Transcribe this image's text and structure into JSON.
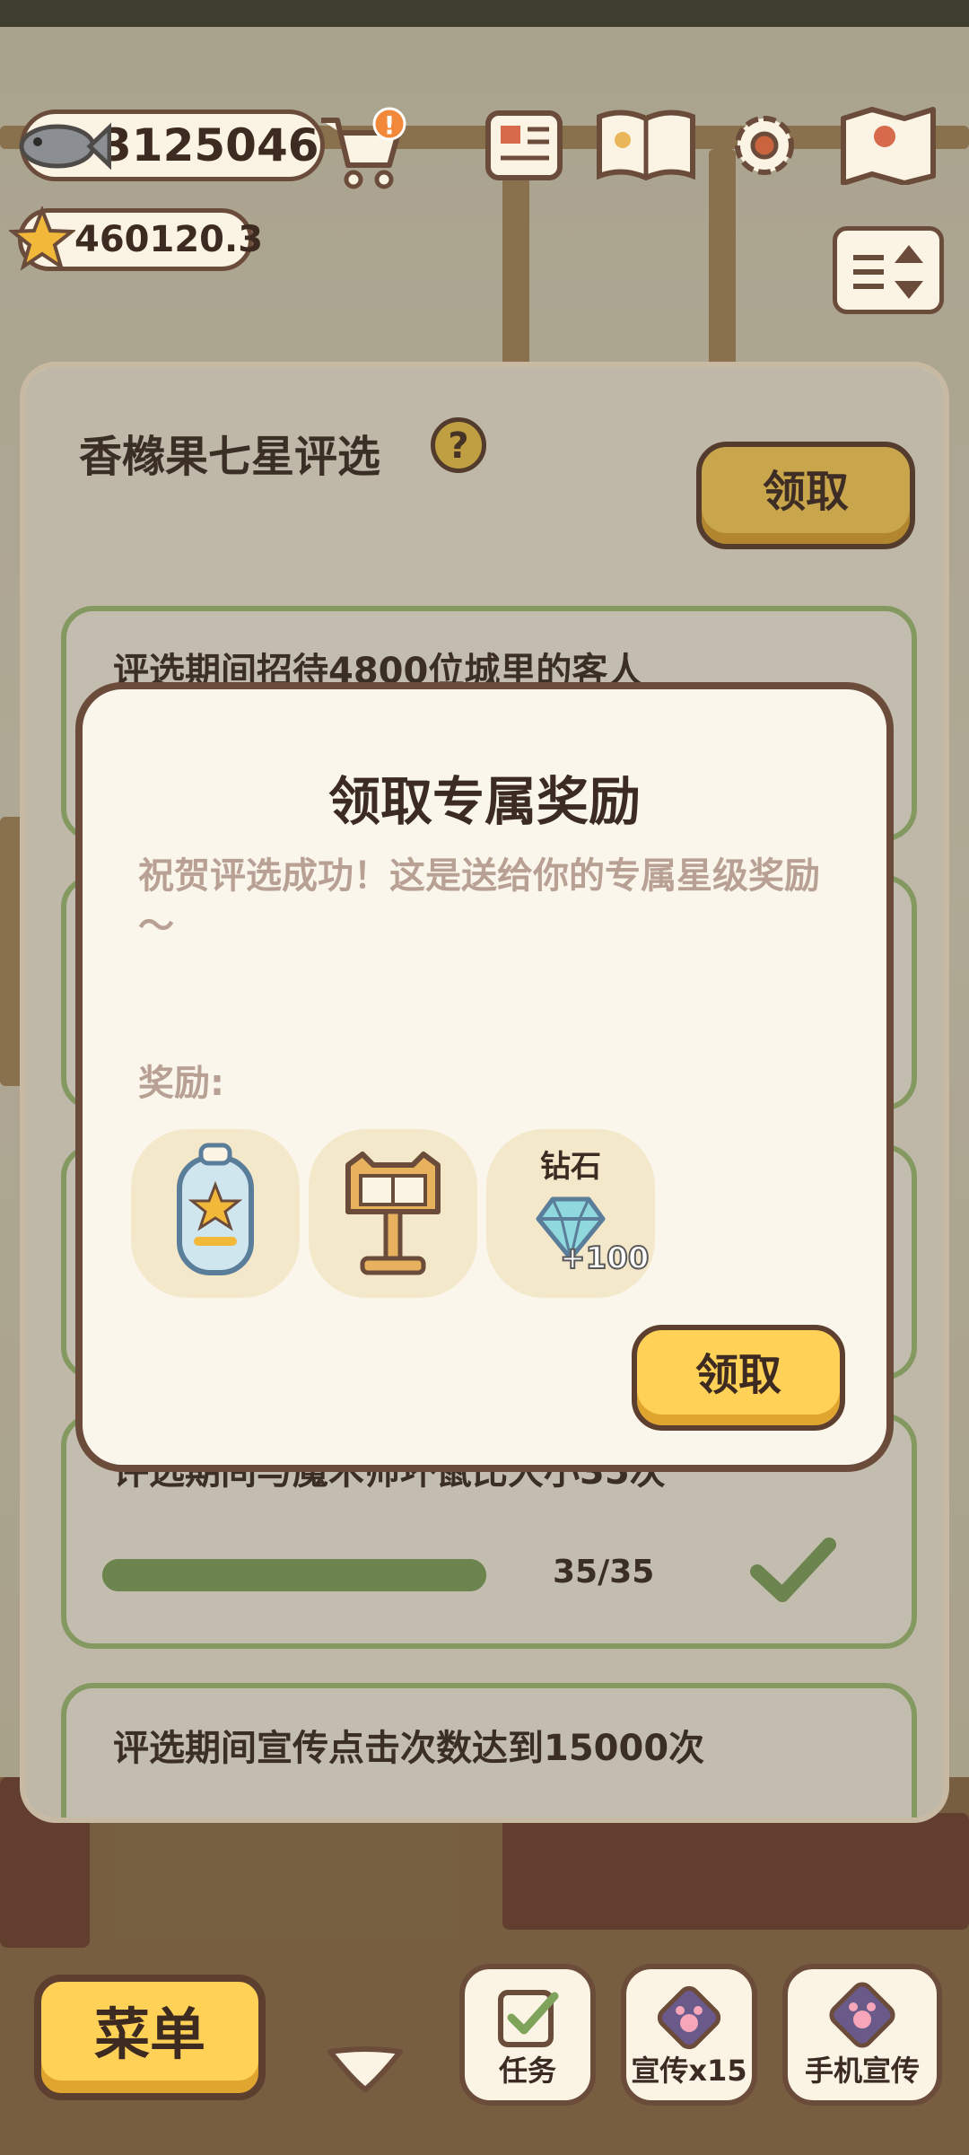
{
  "hud": {
    "fish_count": "3125046",
    "star_rating": "460120.3"
  },
  "panel": {
    "title": "香橼果七星评选",
    "claim_label": "领取",
    "tasks": [
      {
        "title": "评选期间招待4800位城里的客人"
      },
      {
        "title": "评选期间与魔术师坏鼠比大小35次",
        "progress_text": "35/35",
        "progress_fraction": 1.0
      },
      {
        "title": "评选期间宣传点击次数达到15000次"
      }
    ]
  },
  "dialog": {
    "title": "领取专属奖励",
    "message": "祝贺评选成功！这是送给你的专属星级奖励～",
    "reward_label": "奖励:",
    "rewards": [
      {
        "icon": "trophy-badge-icon"
      },
      {
        "icon": "recipe-stand-icon"
      },
      {
        "name": "钻石",
        "icon": "diamond-icon",
        "count": "+100"
      }
    ],
    "claim_label": "领取"
  },
  "bottom_bar": {
    "menu_label": "菜单",
    "task_label": "任务",
    "promote_label": "宣传x15",
    "phone_promote_label": "手机宣传"
  },
  "colors": {
    "accent_yellow": "#ffd157",
    "border_brown": "#6b4b3a",
    "task_border_green": "#9fbf74",
    "dialog_bg": "#fbf6ec"
  }
}
